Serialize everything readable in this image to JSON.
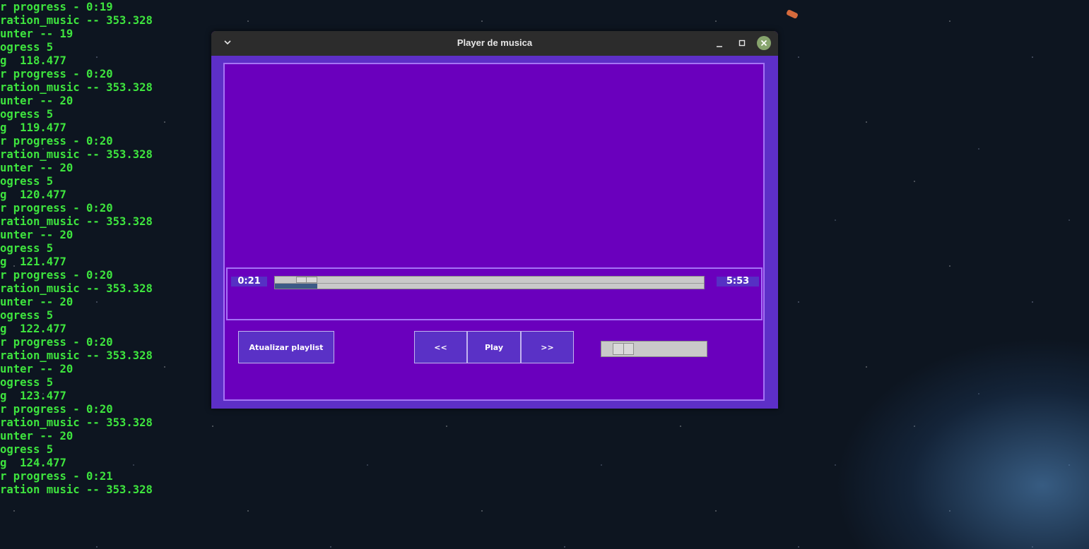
{
  "terminal": {
    "lines": [
      "r progress - 0:19",
      "ration_music -- 353.328",
      "unter -- 19",
      "ogress 5",
      "g  118.477",
      "r progress - 0:20",
      "ration_music -- 353.328",
      "unter -- 20",
      "ogress 5",
      "g  119.477",
      "r progress - 0:20",
      "ration_music -- 353.328",
      "unter -- 20",
      "ogress 5",
      "g  120.477",
      "r progress - 0:20",
      "ration_music -- 353.328",
      "unter -- 20",
      "ogress 5",
      "g  121.477",
      "r progress - 0:20",
      "ration_music -- 353.328",
      "unter -- 20",
      "ogress 5",
      "g  122.477",
      "r progress - 0:20",
      "ration_music -- 353.328",
      "unter -- 20",
      "ogress 5",
      "g  123.477",
      "r progress - 0:20",
      "ration_music -- 353.328",
      "unter -- 20",
      "ogress 5",
      "g  124.477",
      "r progress - 0:21",
      "ration_music -- 353.328"
    ],
    "text_color": "#3ee43e"
  },
  "window": {
    "title": "Player de musica",
    "icons": {
      "menu": "chevron-down-icon",
      "minimize": "minimize-icon",
      "maximize": "maximize-icon",
      "close": "close-icon"
    },
    "colors": {
      "background": "#6a00bd",
      "frame": "#5d2fc7",
      "border": "#a574f5",
      "button": "#5a31c6"
    }
  },
  "player": {
    "current_time": "0:21",
    "total_time": "5:53",
    "progress_fraction": 0.049,
    "volume_fraction": 0.05,
    "buttons": {
      "refresh_playlist": "Atualizar playlist",
      "previous": "<<",
      "play": "Play",
      "next": ">>"
    }
  }
}
